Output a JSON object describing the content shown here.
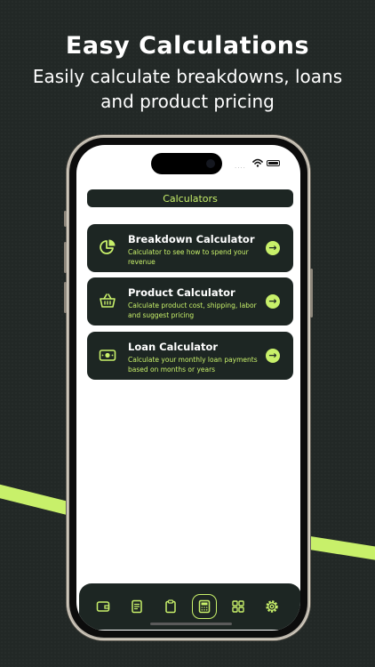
{
  "header": {
    "title": "Easy Calculations",
    "subtitle_line1": "Easily calculate breakdowns, loans",
    "subtitle_line2": "and product pricing"
  },
  "status_bar": {
    "signal_dots": "....",
    "wifi": "wifi-icon",
    "battery": "battery-icon"
  },
  "screen": {
    "title": "Calculators",
    "cards": [
      {
        "title": "Breakdown Calculator",
        "description": "Calculator to see how to spend your revenue",
        "icon": "pie-chart-icon"
      },
      {
        "title": "Product Calculator",
        "description": "Calculate product cost, shipping, labor and suggest pricing",
        "icon": "basket-icon"
      },
      {
        "title": "Loan Calculator",
        "description": "Calculate your monthly loan payments based on months or years",
        "icon": "cash-icon"
      }
    ]
  },
  "tabbar": {
    "items": [
      "wallet-icon",
      "document-icon",
      "clipboard-icon",
      "calculator-icon",
      "grid-icon",
      "settings-icon"
    ],
    "active": "calculator-icon"
  },
  "colors": {
    "accent": "#c8f06a",
    "card": "#1d2623",
    "background": "#222826"
  }
}
